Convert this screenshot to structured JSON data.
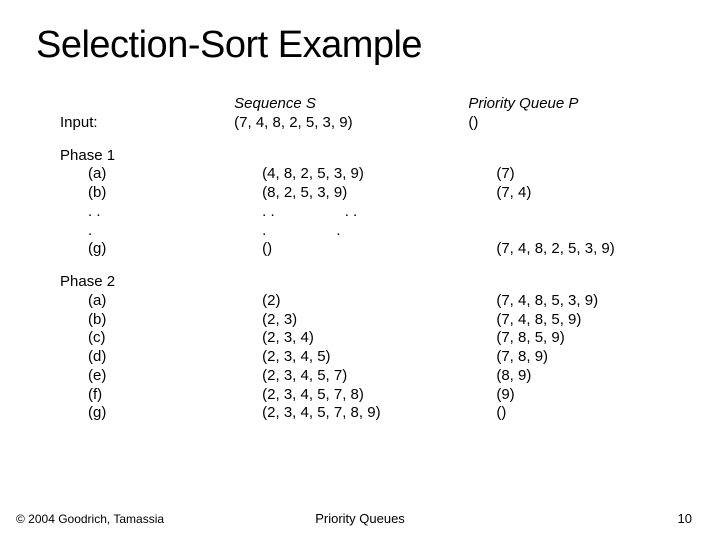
{
  "title": "Selection-Sort Example",
  "headers": {
    "seq_label_prefix": "Sequence ",
    "seq_label_var": "S",
    "pq_label_prefix": "Priority Queue ",
    "pq_label_var": "P"
  },
  "input": {
    "label": "Input:",
    "seq": "(7, 4, 8, 2, 5, 3, 9)",
    "pq": "()"
  },
  "phase1": {
    "label": "Phase 1",
    "rows": [
      {
        "step": "(a)",
        "seq": "(4, 8, 2, 5, 3, 9)",
        "pq": "(7)"
      },
      {
        "step": "(b)",
        "seq": "(8, 2, 5, 3, 9)",
        "pq": "(7, 4)"
      }
    ],
    "dots1": {
      "step": ". .",
      "seq_a": ". .",
      "seq_b": ". .",
      "pq": ""
    },
    "dots2": {
      "step": ".",
      "seq_a": ".",
      "seq_b": ".",
      "pq": ""
    },
    "last": {
      "step": "(g)",
      "seq": "()",
      "pq": "(7, 4, 8, 2, 5, 3, 9)"
    }
  },
  "phase2": {
    "label": "Phase 2",
    "rows": [
      {
        "step": "(a)",
        "seq": "(2)",
        "pq": "(7, 4, 8, 5, 3, 9)"
      },
      {
        "step": "(b)",
        "seq": "(2, 3)",
        "pq": "(7, 4, 8, 5, 9)"
      },
      {
        "step": "(c)",
        "seq": "(2, 3, 4)",
        "pq": "(7, 8, 5, 9)"
      },
      {
        "step": "(d)",
        "seq": "(2, 3, 4, 5)",
        "pq": "(7, 8, 9)"
      },
      {
        "step": "(e)",
        "seq": "(2, 3, 4, 5, 7)",
        "pq": "(8, 9)"
      },
      {
        "step": "(f)",
        "seq": "(2, 3, 4, 5, 7, 8)",
        "pq": "(9)"
      },
      {
        "step": "(g)",
        "seq": "(2, 3, 4, 5, 7, 8, 9)",
        "pq": "()"
      }
    ]
  },
  "footer": {
    "left": "© 2004 Goodrich, Tamassia",
    "center": "Priority Queues",
    "right": "10"
  }
}
